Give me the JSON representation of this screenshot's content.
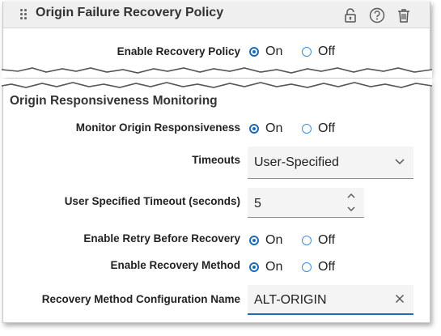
{
  "policy": {
    "title": "Origin Failure Recovery Policy",
    "icons": [
      "lock-icon",
      "help-icon",
      "trash-icon"
    ],
    "enable_recovery": {
      "label": "Enable Recovery Policy",
      "on": "On",
      "off": "Off",
      "selected": "On"
    }
  },
  "monitoring": {
    "title": "Origin Responsiveness Monitoring",
    "monitor": {
      "label": "Monitor Origin Responsiveness",
      "on": "On",
      "off": "Off",
      "selected": "On"
    },
    "timeouts": {
      "label": "Timeouts",
      "value": "User-Specified"
    },
    "user_timeout": {
      "label": "User Specified Timeout (seconds)",
      "value": "5"
    },
    "retry": {
      "label": "Enable Retry Before Recovery",
      "on": "On",
      "off": "Off",
      "selected": "On"
    },
    "recovery_method": {
      "label": "Enable Recovery Method",
      "on": "On",
      "off": "Off",
      "selected": "On"
    },
    "config_name": {
      "label": "Recovery Method Configuration Name",
      "value": "ALT-ORIGIN"
    }
  },
  "colors": {
    "accent": "#1f6bb5",
    "header_bg": "#efefef",
    "field_bg": "#f4f4f4"
  }
}
